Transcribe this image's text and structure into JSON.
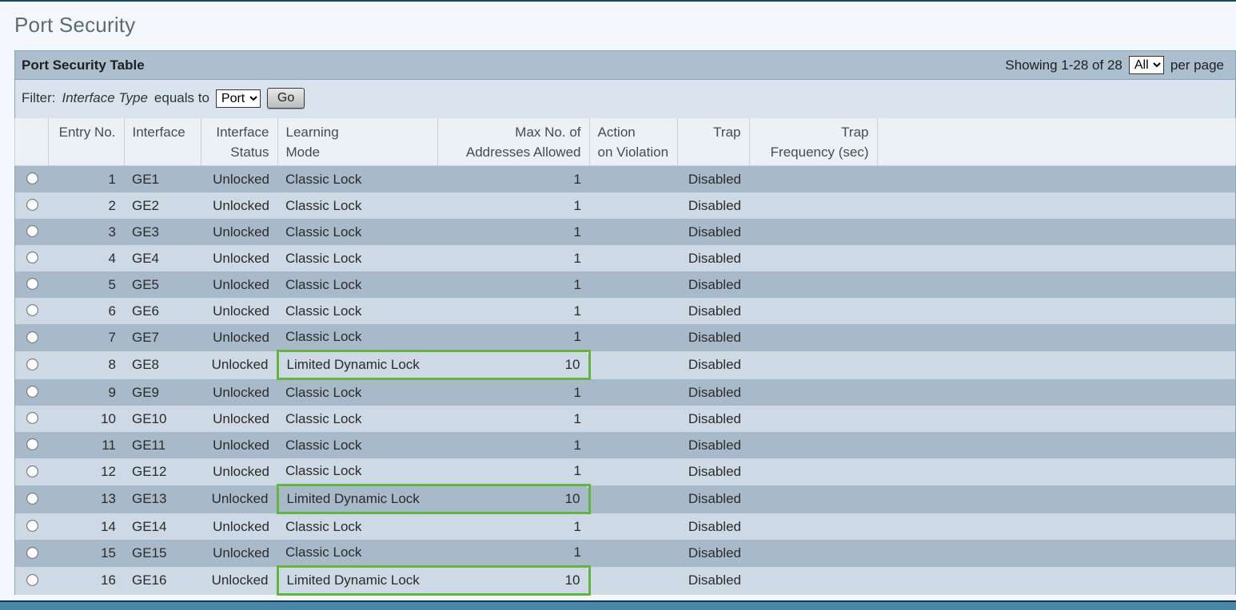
{
  "page": {
    "title": "Port Security"
  },
  "panel": {
    "title": "Port Security Table",
    "showing": "Showing 1-28 of 28",
    "perpage_options": [
      "All"
    ],
    "perpage_selected": "All",
    "perpage_suffix": "per page"
  },
  "filter": {
    "label": "Filter:",
    "field_label": "Interface Type",
    "equals_text": "equals to",
    "options": [
      "Port"
    ],
    "selected": "Port",
    "go_label": "Go"
  },
  "columns": {
    "radio": "",
    "entry_no": "Entry No.",
    "interface": "Interface",
    "interface_status_l1": "Interface",
    "interface_status_l2": "Status",
    "learning_mode_l1": "Learning",
    "learning_mode_l2": "Mode",
    "max_addr_l1": "Max No. of",
    "max_addr_l2": "Addresses Allowed",
    "action_l1": "Action",
    "action_l2": "on Violation",
    "trap": "Trap",
    "trap_freq_l1": "Trap",
    "trap_freq_l2": "Frequency (sec)"
  },
  "rows": [
    {
      "n": 1,
      "iface": "GE1",
      "status": "Unlocked",
      "mode": "Classic Lock",
      "max": 1,
      "action": "",
      "trap": "Disabled",
      "freq": "",
      "hl": false
    },
    {
      "n": 2,
      "iface": "GE2",
      "status": "Unlocked",
      "mode": "Classic Lock",
      "max": 1,
      "action": "",
      "trap": "Disabled",
      "freq": "",
      "hl": false
    },
    {
      "n": 3,
      "iface": "GE3",
      "status": "Unlocked",
      "mode": "Classic Lock",
      "max": 1,
      "action": "",
      "trap": "Disabled",
      "freq": "",
      "hl": false
    },
    {
      "n": 4,
      "iface": "GE4",
      "status": "Unlocked",
      "mode": "Classic Lock",
      "max": 1,
      "action": "",
      "trap": "Disabled",
      "freq": "",
      "hl": false
    },
    {
      "n": 5,
      "iface": "GE5",
      "status": "Unlocked",
      "mode": "Classic Lock",
      "max": 1,
      "action": "",
      "trap": "Disabled",
      "freq": "",
      "hl": false
    },
    {
      "n": 6,
      "iface": "GE6",
      "status": "Unlocked",
      "mode": "Classic Lock",
      "max": 1,
      "action": "",
      "trap": "Disabled",
      "freq": "",
      "hl": false
    },
    {
      "n": 7,
      "iface": "GE7",
      "status": "Unlocked",
      "mode": "Classic Lock",
      "max": 1,
      "action": "",
      "trap": "Disabled",
      "freq": "",
      "hl": false
    },
    {
      "n": 8,
      "iface": "GE8",
      "status": "Unlocked",
      "mode": "Limited Dynamic Lock",
      "max": 10,
      "action": "",
      "trap": "Disabled",
      "freq": "",
      "hl": true
    },
    {
      "n": 9,
      "iface": "GE9",
      "status": "Unlocked",
      "mode": "Classic Lock",
      "max": 1,
      "action": "",
      "trap": "Disabled",
      "freq": "",
      "hl": false
    },
    {
      "n": 10,
      "iface": "GE10",
      "status": "Unlocked",
      "mode": "Classic Lock",
      "max": 1,
      "action": "",
      "trap": "Disabled",
      "freq": "",
      "hl": false
    },
    {
      "n": 11,
      "iface": "GE11",
      "status": "Unlocked",
      "mode": "Classic Lock",
      "max": 1,
      "action": "",
      "trap": "Disabled",
      "freq": "",
      "hl": false
    },
    {
      "n": 12,
      "iface": "GE12",
      "status": "Unlocked",
      "mode": "Classic Lock",
      "max": 1,
      "action": "",
      "trap": "Disabled",
      "freq": "",
      "hl": false
    },
    {
      "n": 13,
      "iface": "GE13",
      "status": "Unlocked",
      "mode": "Limited Dynamic Lock",
      "max": 10,
      "action": "",
      "trap": "Disabled",
      "freq": "",
      "hl": true
    },
    {
      "n": 14,
      "iface": "GE14",
      "status": "Unlocked",
      "mode": "Classic Lock",
      "max": 1,
      "action": "",
      "trap": "Disabled",
      "freq": "",
      "hl": false
    },
    {
      "n": 15,
      "iface": "GE15",
      "status": "Unlocked",
      "mode": "Classic Lock",
      "max": 1,
      "action": "",
      "trap": "Disabled",
      "freq": "",
      "hl": false
    },
    {
      "n": 16,
      "iface": "GE16",
      "status": "Unlocked",
      "mode": "Limited Dynamic Lock",
      "max": 10,
      "action": "",
      "trap": "Disabled",
      "freq": "",
      "hl": true
    }
  ]
}
